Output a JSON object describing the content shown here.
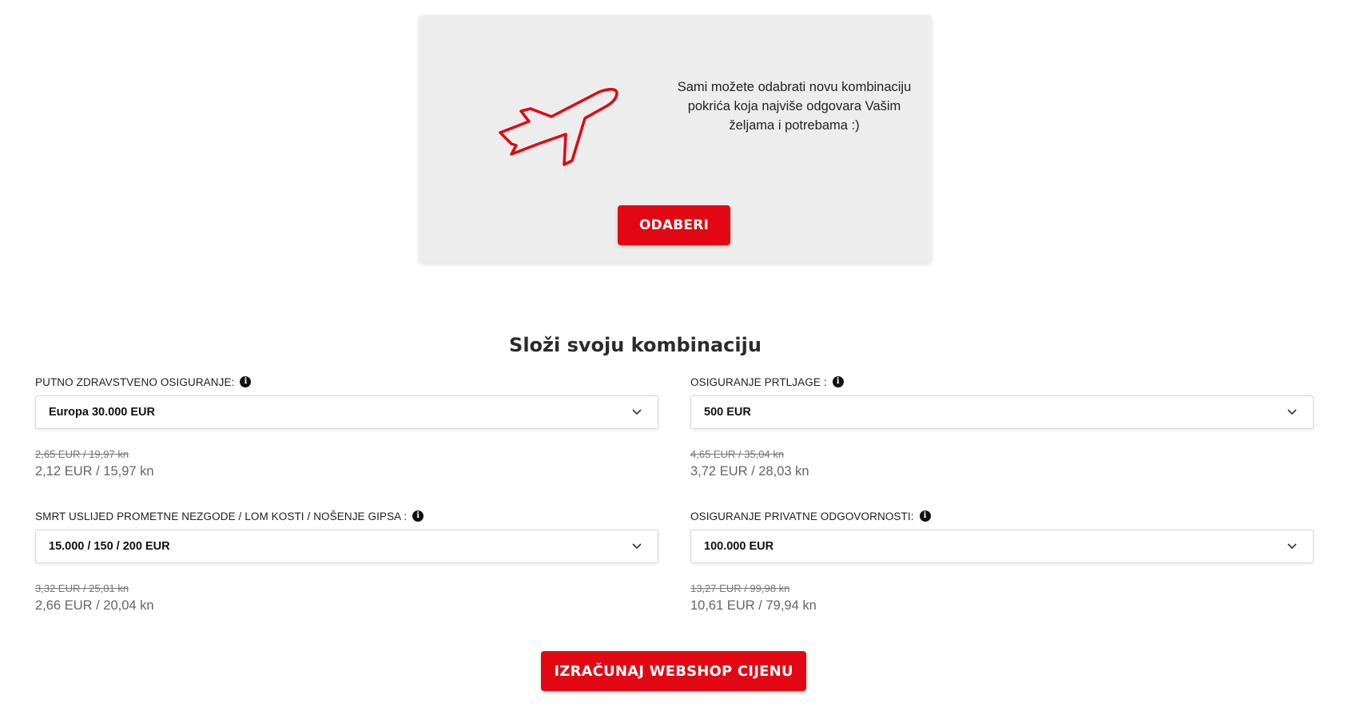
{
  "promo": {
    "text": "Sami možete odabrati novu kombinaciju pokrića koja najviše odgovara Vašim željama i potrebama :)",
    "button_label": "ODABERI",
    "icon": "airplane-icon",
    "accent_color": "#e30613"
  },
  "section": {
    "title": "Složi svoju kombinaciju"
  },
  "options": [
    {
      "label": "PUTNO ZDRAVSTVENO OSIGURANJE:",
      "selected": "Europa 30.000 EUR",
      "price_old": "2,65 EUR / 19,97 kn",
      "price_new": "2,12 EUR / 15,97 kn"
    },
    {
      "label": "OSIGURANJE PRTLJAGE :",
      "selected": "500 EUR",
      "price_old": "4,65 EUR / 35,04 kn",
      "price_new": "3,72 EUR / 28,03 kn"
    },
    {
      "label": "SMRT USLIJED PROMETNE NEZGODE / LOM KOSTI / NOŠENJE GIPSA :",
      "selected": "15.000 / 150 / 200 EUR",
      "price_old": "3,32 EUR / 25,01 kn",
      "price_new": "2,66 EUR / 20,04 kn"
    },
    {
      "label": "OSIGURANJE PRIVATNE ODGOVORNOSTI:",
      "selected": "100.000 EUR",
      "price_old": "13,27 EUR / 99,98 kn",
      "price_new": "10,61 EUR / 79,94 kn"
    }
  ],
  "calc_button_label": "IZRAČUNAJ WEBSHOP CIJENU"
}
